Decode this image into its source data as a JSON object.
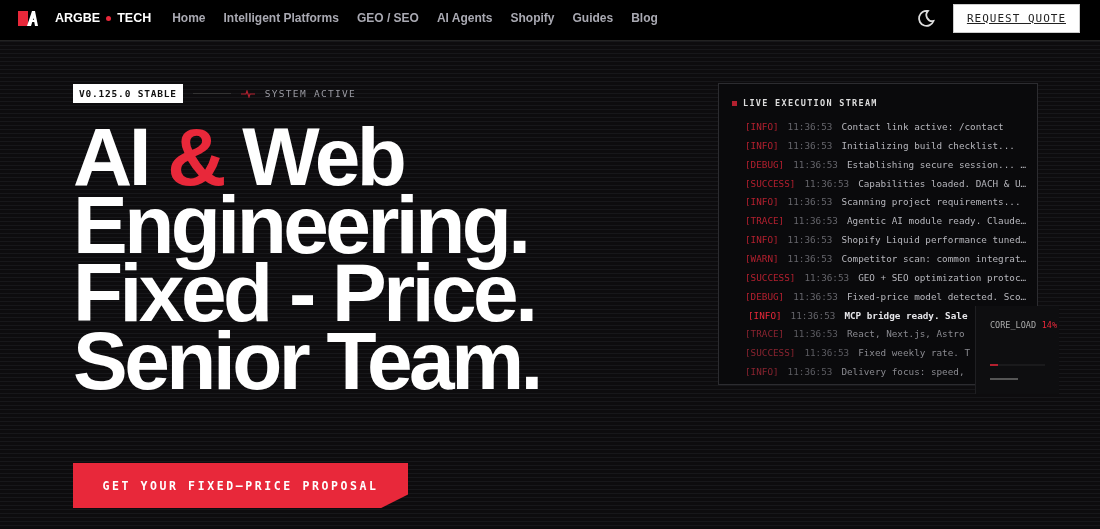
{
  "header": {
    "brand": {
      "left": "ARGBE",
      "right": "TECH"
    },
    "nav": [
      {
        "label": "Home"
      },
      {
        "label": "Intelligent Platforms"
      },
      {
        "label": "GEO / SEO"
      },
      {
        "label": "AI Agents"
      },
      {
        "label": "Shopify"
      },
      {
        "label": "Guides"
      },
      {
        "label": "Blog"
      }
    ],
    "cta": "REQUEST QUOTE"
  },
  "hero": {
    "version": "V0.125.0 STABLE",
    "status": "SYSTEM ACTIVE",
    "headline": [
      [
        {
          "text": "AI ",
          "accent": false
        },
        {
          "text": "&",
          "accent": true
        },
        {
          "text": " Web",
          "accent": false
        }
      ],
      [
        {
          "text": "Engineering.",
          "accent": false
        }
      ],
      [
        {
          "text": "Fixed - Price.",
          "accent": false
        }
      ],
      [
        {
          "text": "Senior Team.",
          "accent": false
        }
      ]
    ],
    "button": "GET YOUR FIXED–PRICE PROPOSAL"
  },
  "terminal": {
    "title": "LIVE EXECUTION STREAM",
    "lines": [
      {
        "tag": "[INFO]",
        "time": "11:36:53",
        "message": "Contact link active: /contact",
        "active": false,
        "faded": false
      },
      {
        "tag": "[INFO]",
        "time": "11:36:53",
        "message": "Initializing build checklist...",
        "active": false,
        "faded": false
      },
      {
        "tag": "[DEBUG]",
        "time": "11:36:53",
        "message": "Establishing secure session... …",
        "active": false,
        "faded": false
      },
      {
        "tag": "[SUCCESS]",
        "time": "11:36:53",
        "message": "Capabilities loaded. DACH & U…",
        "active": false,
        "faded": false
      },
      {
        "tag": "[INFO]",
        "time": "11:36:53",
        "message": "Scanning project requirements...",
        "active": false,
        "faded": false
      },
      {
        "tag": "[TRACE]",
        "time": "11:36:53",
        "message": "Agentic AI module ready. Claude…",
        "active": false,
        "faded": false
      },
      {
        "tag": "[INFO]",
        "time": "11:36:53",
        "message": "Shopify Liquid performance tuned…",
        "active": false,
        "faded": false
      },
      {
        "tag": "[WARN]",
        "time": "11:36:53",
        "message": "Competitor scan: common integrat…",
        "active": false,
        "faded": false
      },
      {
        "tag": "[SUCCESS]",
        "time": "11:36:53",
        "message": "GEO + SEO optimization protoc…",
        "active": false,
        "faded": false
      },
      {
        "tag": "[DEBUG]",
        "time": "11:36:53",
        "message": "Fixed-price model detected. Sco…",
        "active": false,
        "faded": false
      },
      {
        "tag": "[INFO]",
        "time": "11:36:53",
        "message": "MCP bridge ready. Sale",
        "active": true,
        "faded": false
      },
      {
        "tag": "[TRACE]",
        "time": "11:36:53",
        "message": "React, Next.js, Astro",
        "active": false,
        "faded": true
      },
      {
        "tag": "[SUCCESS]",
        "time": "11:36:53",
        "message": "Fixed weekly rate. T",
        "active": false,
        "faded": true
      },
      {
        "tag": "[INFO]",
        "time": "11:36:53",
        "message": "Delivery focus: speed,",
        "active": false,
        "faded": true
      }
    ],
    "load": {
      "label": "CORE_LOAD",
      "reading": "14%",
      "level": 0.14
    }
  }
}
